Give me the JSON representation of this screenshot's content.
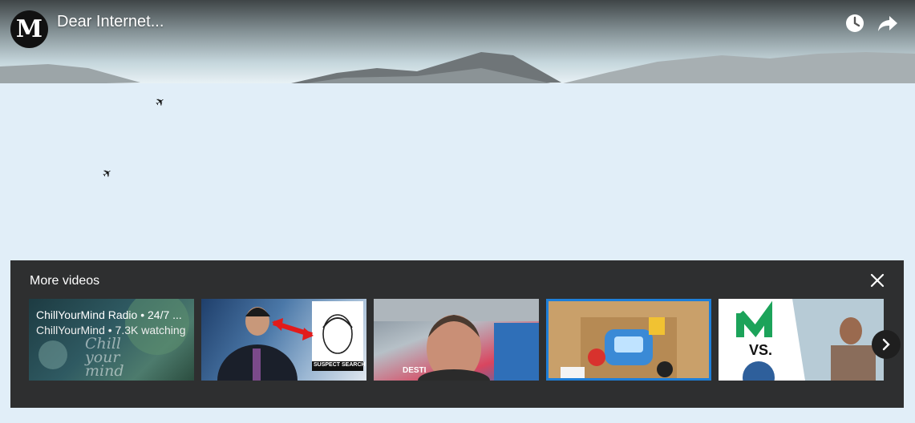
{
  "player": {
    "title": "Dear Internet...",
    "channel_logo_letter": "M",
    "icons": [
      "clock-icon",
      "share-arrow-icon"
    ]
  },
  "more_videos": {
    "heading": "More videos",
    "videos": [
      {
        "title": "ChillYourMind Radio • 24/7 ...",
        "subtitle": "ChillYourMind • 7.3K watching",
        "thumb_text": "Chill your mind"
      },
      {
        "title": "",
        "subtitle": "",
        "thumb_text": "SUSPECT SEARCH"
      },
      {
        "title": "",
        "subtitle": "",
        "thumb_text": "DESTI"
      },
      {
        "title": "",
        "subtitle": "",
        "thumb_text": ""
      },
      {
        "title": "",
        "subtitle": "",
        "thumb_text": "VS."
      }
    ]
  },
  "colors": {
    "panel": "#202020",
    "sky_top": "#3f4547",
    "background": "#e1eef8"
  }
}
